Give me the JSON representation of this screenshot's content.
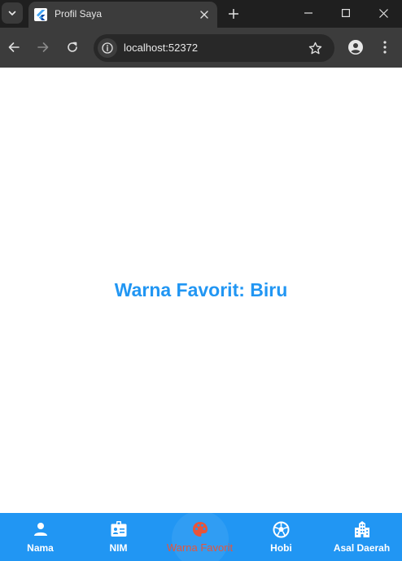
{
  "browser": {
    "tab_title": "Profil Saya",
    "url": "localhost:52372"
  },
  "page": {
    "main_text": "Warna Favorit: Biru"
  },
  "bottom_nav": {
    "items": [
      {
        "label": "Nama",
        "icon": "person-icon"
      },
      {
        "label": "NIM",
        "icon": "badge-icon"
      },
      {
        "label": "Warna Favorit",
        "icon": "palette-icon"
      },
      {
        "label": "Hobi",
        "icon": "soccer-ball-icon"
      },
      {
        "label": "Asal Daerah",
        "icon": "location-city-icon"
      }
    ],
    "active_index": 2
  },
  "colors": {
    "accent": "#2196f3",
    "active_item": "#e8543a",
    "chrome_dark": "#1f1f1f",
    "chrome_toolbar": "#3c3c3c"
  }
}
